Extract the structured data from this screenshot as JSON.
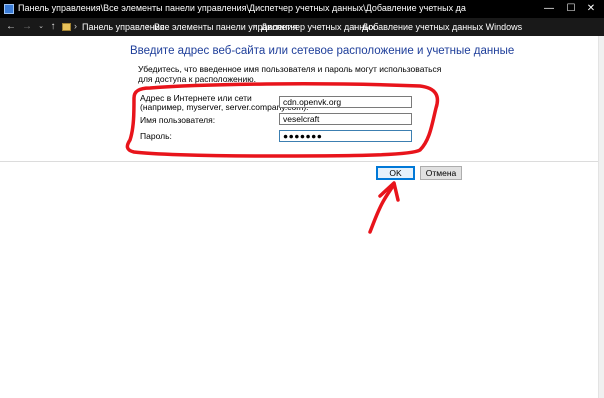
{
  "window": {
    "title": "Панель управления\\Все элементы панели управления\\Диспетчер учетных данных\\Добавление учетных да",
    "minimize_glyph": "—",
    "maximize_glyph": "☐",
    "close_glyph": "✕"
  },
  "addressbar": {
    "back_glyph": "←",
    "forward_glyph": "→",
    "history_glyph": "⌄",
    "up_glyph": "↑",
    "separator": "›",
    "crumbs": [
      "Панель управления",
      "Все элементы панели управления",
      "Диспетчер учетных данных",
      "Добавление учетных данных Windows"
    ]
  },
  "form": {
    "heading": "Введите адрес веб-сайта или сетевое расположение и учетные данные",
    "description": "Убедитесь, что введенное имя пользователя и пароль могут использоваться для доступа к расположению.",
    "address_label_line1": "Адрес в Интернете или сети",
    "address_label_line2": "(например, myserver, server.company.com):",
    "address_value": "cdn.openvk.org",
    "username_label": "Имя пользователя:",
    "username_value": "veselcraft",
    "password_label": "Пароль:",
    "password_value": "●●●●●●●"
  },
  "buttons": {
    "ok": "OK",
    "cancel": "Отмена"
  },
  "annotation": {
    "color": "#e8141b"
  }
}
